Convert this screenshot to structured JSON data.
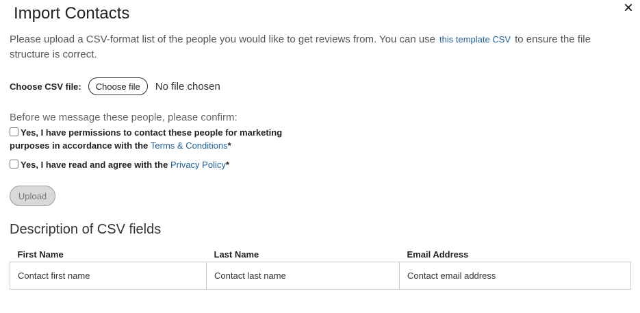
{
  "dialog": {
    "title": "Import Contacts",
    "close_icon": "×"
  },
  "intro": {
    "text_before": "Please upload a CSV-format list of the people you would like to get reviews from. You can use",
    "template_link": "this template CSV",
    "text_after": "to ensure the file structure is correct."
  },
  "file_input": {
    "label": "Choose CSV file:",
    "button_label": "Choose file",
    "status": "No file chosen"
  },
  "confirm": {
    "heading": "Before we message these people, please confirm:",
    "permissions": {
      "text": "Yes, I have permissions to contact these people for marketing purposes in accordance with the",
      "link": "Terms & Conditions",
      "required": "*",
      "checked": false
    },
    "privacy": {
      "text": "Yes, I have read and agree with the",
      "link": "Privacy Policy",
      "required": "*",
      "checked": false
    }
  },
  "upload": {
    "label": "Upload",
    "disabled": true
  },
  "csv_fields": {
    "title": "Description of CSV fields",
    "headers": [
      "First Name",
      "Last Name",
      "Email Address"
    ],
    "rows": [
      [
        "Contact first name",
        "Contact last name",
        "Contact email address"
      ]
    ]
  }
}
